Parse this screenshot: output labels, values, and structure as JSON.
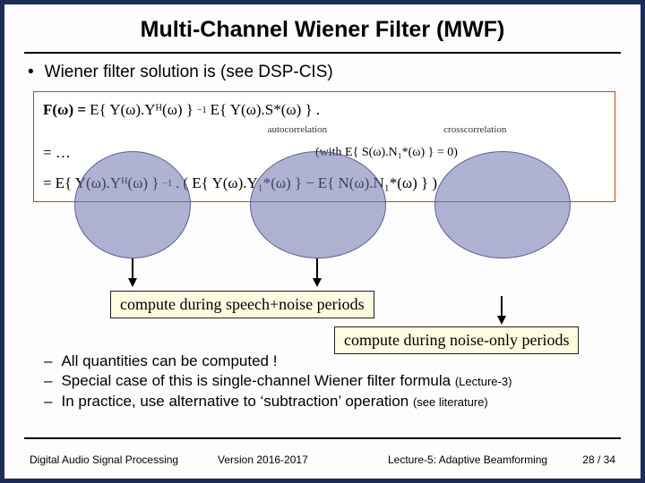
{
  "title": "Multi-Channel Wiener Filter (MWF)",
  "bullet_main": "Wiener filter solution is (see DSP-CIS)",
  "eq": {
    "line1_lhs": "F(ω) =",
    "term_auto": "E{ Y(ω).Yᴴ(ω) }",
    "inv": "−1",
    "term_cross": "E{ Y(ω).S*(ω) }",
    "period": ".",
    "under_auto": "autocorrelation",
    "under_cross": "crosscorrelation",
    "line2_lhs": "= …",
    "line2_note": "(with E{ S(ω).N₁*(ω) } = 0)",
    "line3_lhs": "=",
    "line3_a": "E{ Y(ω).Yᴴ(ω) }",
    "line3_dot": ".",
    "line3_b": "( E{ Y(ω).Y₁*(ω) }",
    "line3_minus": "−",
    "line3_c": "E{ N(ω).N₁*(ω) } )"
  },
  "callout_speech_noise": "compute during speech+noise periods",
  "callout_noise_only": "compute during noise-only periods",
  "sub": {
    "a": "All quantities can be computed !",
    "b_main": "Special case of this is single-channel Wiener filter formula ",
    "b_small": "(Lecture-3)",
    "c_main": "In practice, use alternative to ‘subtraction’ operation ",
    "c_small": "(see literature)"
  },
  "footer": {
    "left": "Digital Audio Signal Processing",
    "version": "Version 2016-2017",
    "lecture": "Lecture-5: Adaptive Beamforming",
    "page": "28 / 34"
  }
}
